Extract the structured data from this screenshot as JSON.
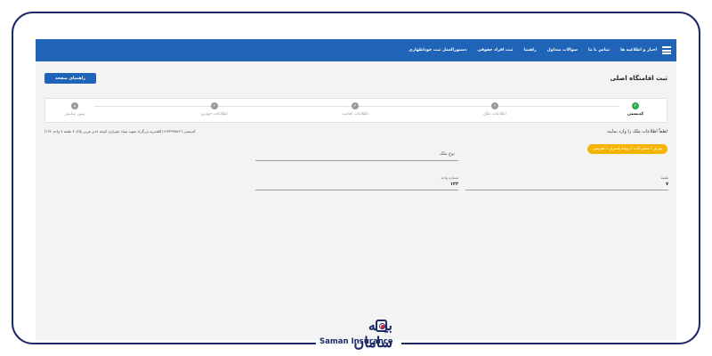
{
  "navbar": {
    "items": [
      "اخبار و اطلاعیه ها",
      "تماس با ما",
      "سوالات متداول",
      "راهنما",
      "ثبت افراد حقوقی",
      "دستورالعمل ثبت خوداظهاری"
    ],
    "menu_icon": "hamburger-icon"
  },
  "page": {
    "title": "ثبت اقامتگاه اصلی",
    "help_button": "راهنمای صفحه"
  },
  "stepper": {
    "steps": [
      {
        "number": "✓",
        "label": "کدپستی",
        "state": "done"
      },
      {
        "number": "۲",
        "label": "اطلاعات ملک",
        "state": "pending"
      },
      {
        "number": "۳",
        "label": "اطلاعات اقامت",
        "state": "pending"
      },
      {
        "number": "۴",
        "label": "اطلاعات خودرو",
        "state": "pending"
      },
      {
        "number": "۵",
        "label": "پیش نمایش",
        "state": "pending"
      }
    ],
    "done_color": "#2fa84f",
    "pending_color": "#9a9a9a"
  },
  "address": {
    "instruction": "لطفاً اطلاعات ملک را وارد نمایید",
    "postal_text": "کدپستی:۱۶۶۳۳۳۳۵۶۲۱(قلندریه بزرگراه شهید صیاد شیرازی کوچه ۸دی غربی پلاک ۷ طبقه ۷ واحد ۱۳۲)",
    "breadcrumb": "تهران / شمیرانات / رودبارقصران / تجریش",
    "breadcrumb_color": "#f5b400"
  },
  "form": {
    "property_type_placeholder": "نوع ملک",
    "floor_label": "طبقه",
    "floor_value": "۷",
    "unit_label": "شماره واحد",
    "unit_value": "۱۳۲"
  },
  "logo": {
    "fa": "بیمه سامان",
    "en": "Saman Insurance"
  },
  "colors": {
    "brand_blue": "#1f64b6",
    "frame_navy": "#1b2a66",
    "logo_red": "#d81f2a"
  }
}
